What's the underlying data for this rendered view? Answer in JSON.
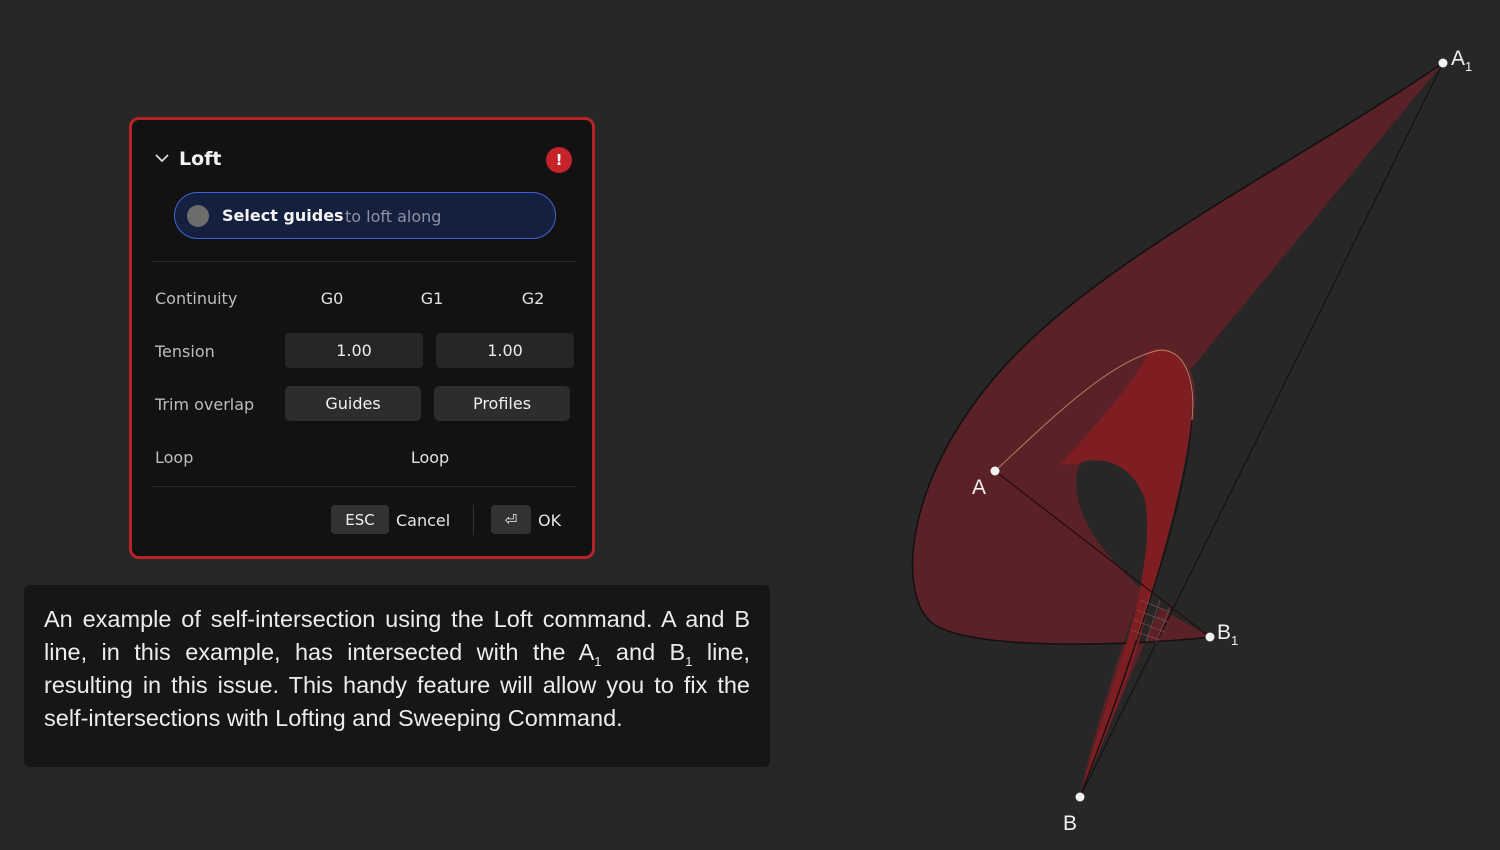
{
  "panel": {
    "title": "Loft",
    "error_glyph": "!",
    "select": {
      "strong": "Select guides",
      "hint": "to loft along"
    },
    "continuity": {
      "label": "Continuity",
      "options": [
        "G0",
        "G1",
        "G2"
      ]
    },
    "tension": {
      "label": "Tension",
      "values": [
        "1.00",
        "1.00"
      ]
    },
    "trim_overlap": {
      "label": "Trim overlap",
      "buttons": [
        "Guides",
        "Profiles"
      ]
    },
    "loop": {
      "label": "Loop",
      "value": "Loop"
    },
    "footer": {
      "esc_key": "ESC",
      "cancel_label": "Cancel",
      "enter_key": "⏎",
      "ok_label": "OK"
    }
  },
  "caption": {
    "part1": "An example of self-intersection using the Loft command.  A and B line, in this example, has intersected with the A",
    "sub1": "1",
    "part2": " and B",
    "sub2": "1",
    "part3": " line, resulting in this issue. This handy feature will allow you to fix the self-intersections with Lofting and Sweeping Command."
  },
  "diagram": {
    "points": {
      "A": {
        "letter": "A"
      },
      "B": {
        "letter": "B"
      },
      "A1": {
        "letter": "A",
        "sub": "1"
      },
      "B1": {
        "letter": "B",
        "sub": "1"
      }
    }
  },
  "colors": {
    "panel_border": "#b5242a",
    "pill_border": "#3f63d6",
    "surface_fill": "#5a2226",
    "surface_fold": "#7e1d22"
  }
}
